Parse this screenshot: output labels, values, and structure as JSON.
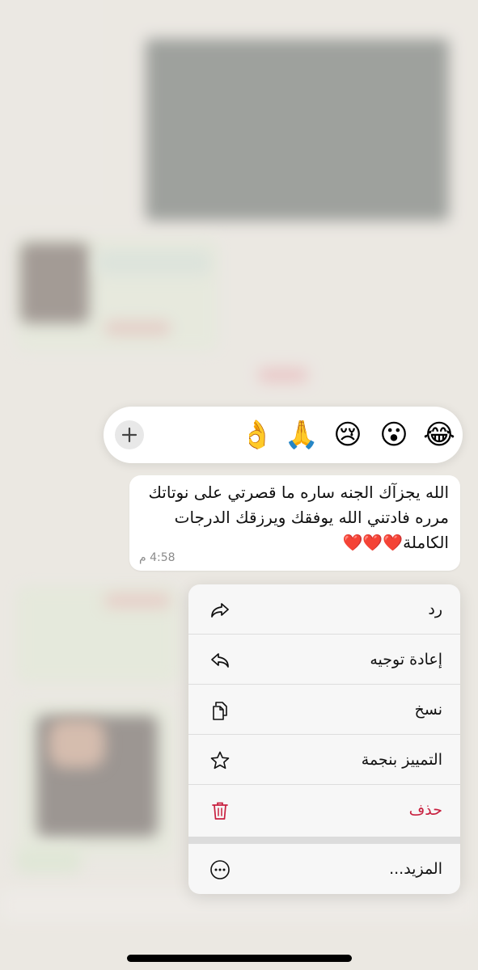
{
  "reactions": {
    "items": [
      "👍",
      "❤️",
      "😂",
      "😮",
      "😢",
      "🙏",
      "👌"
    ],
    "add_icon": "plus-icon"
  },
  "message": {
    "text": "الله يجزآك الجنه ساره ما قصرتي على نوتاتك مرره فادتني الله يوفقك ويرزقك الدرجات الكاملة❤️❤️❤️",
    "time": "4:58 م"
  },
  "menu": {
    "reply": "رد",
    "forward": "إعادة توجيه",
    "copy": "نسخ",
    "star": "التمييز بنجمة",
    "delete": "حذف",
    "more": "المزيد..."
  },
  "colors": {
    "danger": "#c8203f",
    "menu_bg": "#f7f7f7",
    "chat_bg": "#e9e6e1"
  }
}
